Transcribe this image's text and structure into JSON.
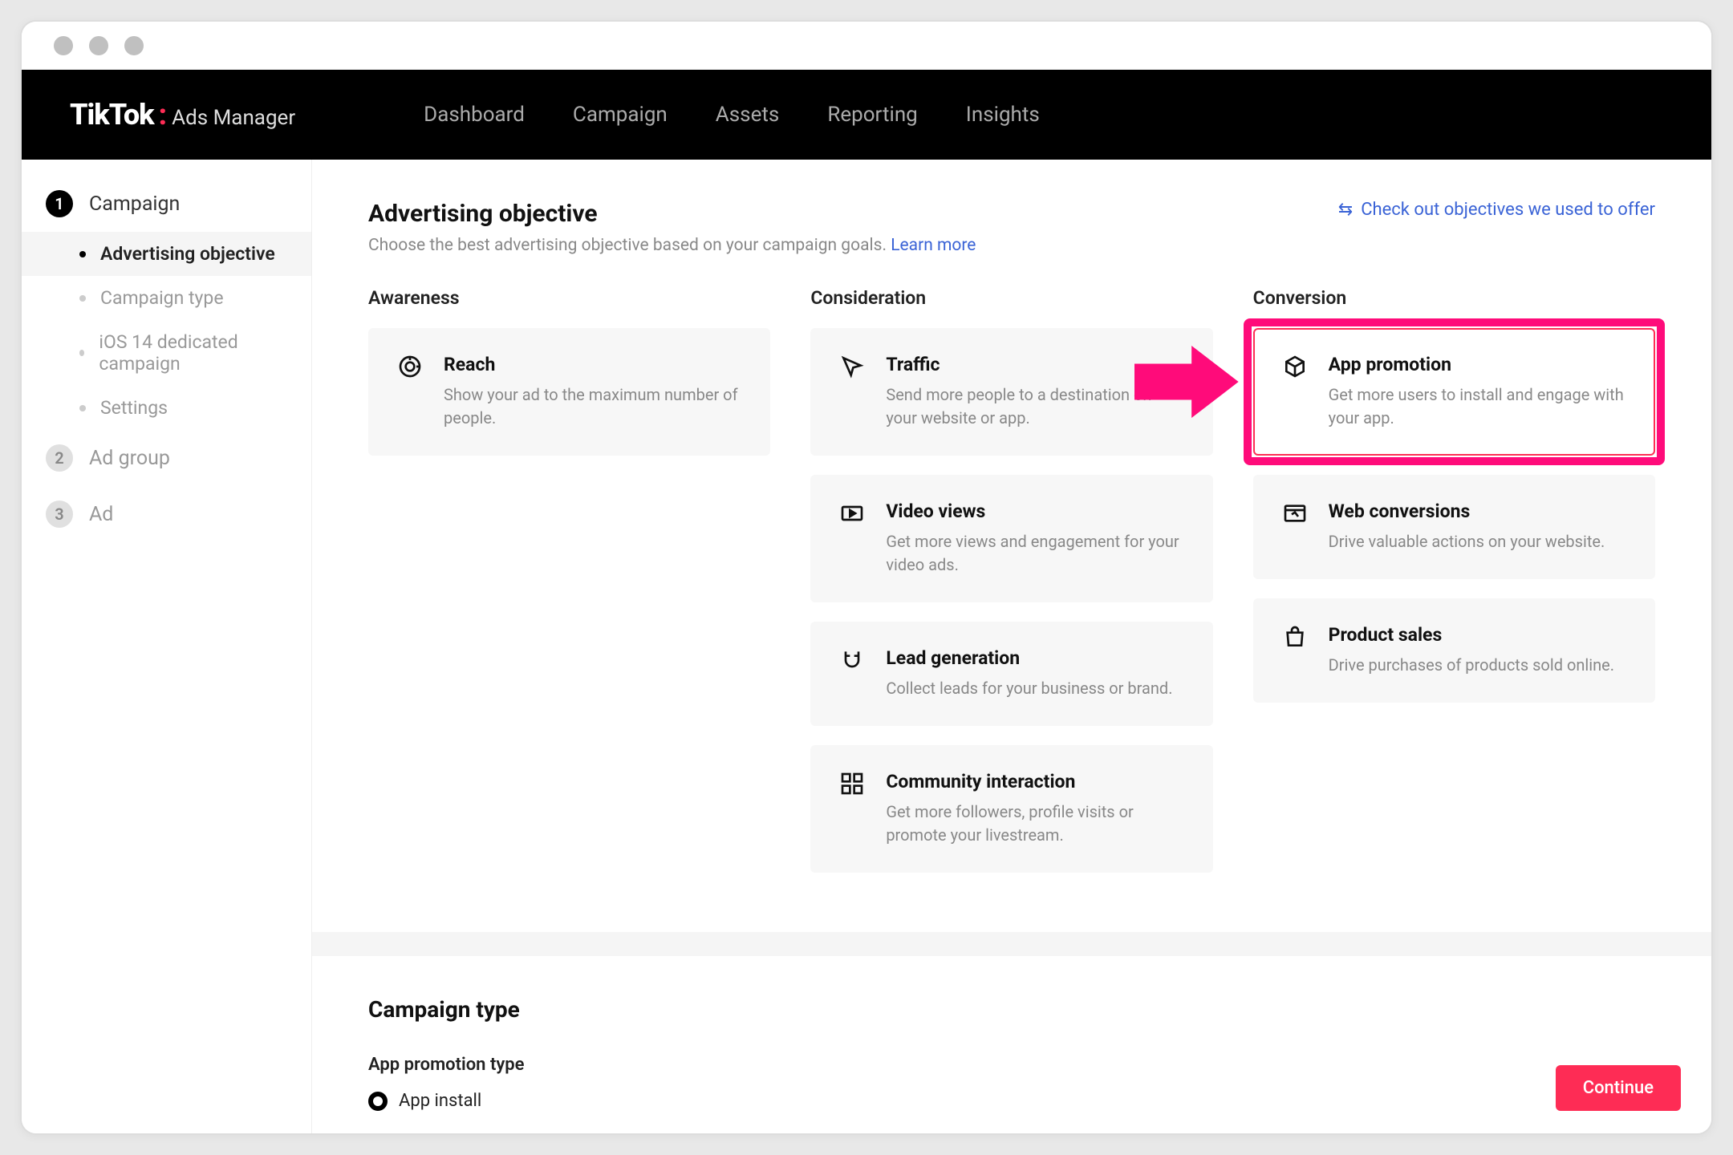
{
  "header": {
    "logo_main": "TikTok",
    "logo_sub": "Ads Manager",
    "nav": [
      "Dashboard",
      "Campaign",
      "Assets",
      "Reporting",
      "Insights"
    ]
  },
  "sidebar": {
    "steps": [
      {
        "num": "1",
        "label": "Campaign",
        "active": true
      },
      {
        "num": "2",
        "label": "Ad group",
        "active": false
      },
      {
        "num": "3",
        "label": "Ad",
        "active": false
      }
    ],
    "subs": [
      {
        "label": "Advertising objective",
        "current": true
      },
      {
        "label": "Campaign type",
        "current": false
      },
      {
        "label": "iOS 14 dedicated campaign",
        "current": false
      },
      {
        "label": "Settings",
        "current": false
      }
    ]
  },
  "objective": {
    "title": "Advertising objective",
    "subtitle": "Choose the best advertising objective based on your campaign goals.",
    "learn_more": "Learn more",
    "offer_link": "Check out objectives we used to offer",
    "columns": {
      "awareness": {
        "heading": "Awareness",
        "cards": [
          {
            "title": "Reach",
            "desc": "Show your ad to the maximum number of people."
          }
        ]
      },
      "consideration": {
        "heading": "Consideration",
        "cards": [
          {
            "title": "Traffic",
            "desc": "Send more people to a destination on your website or app."
          },
          {
            "title": "Video views",
            "desc": "Get more views and engagement for your video ads."
          },
          {
            "title": "Lead generation",
            "desc": "Collect leads for your business or brand."
          },
          {
            "title": "Community interaction",
            "desc": "Get more followers, profile visits or promote your livestream."
          }
        ]
      },
      "conversion": {
        "heading": "Conversion",
        "cards": [
          {
            "title": "App promotion",
            "desc": "Get more users to install and engage with your app."
          },
          {
            "title": "Web conversions",
            "desc": "Drive valuable actions on your website."
          },
          {
            "title": "Product sales",
            "desc": "Drive purchases of products sold online."
          }
        ]
      }
    }
  },
  "campaign_type": {
    "title": "Campaign type",
    "subtitle": "App promotion type",
    "option": "App install"
  },
  "continue": "Continue"
}
